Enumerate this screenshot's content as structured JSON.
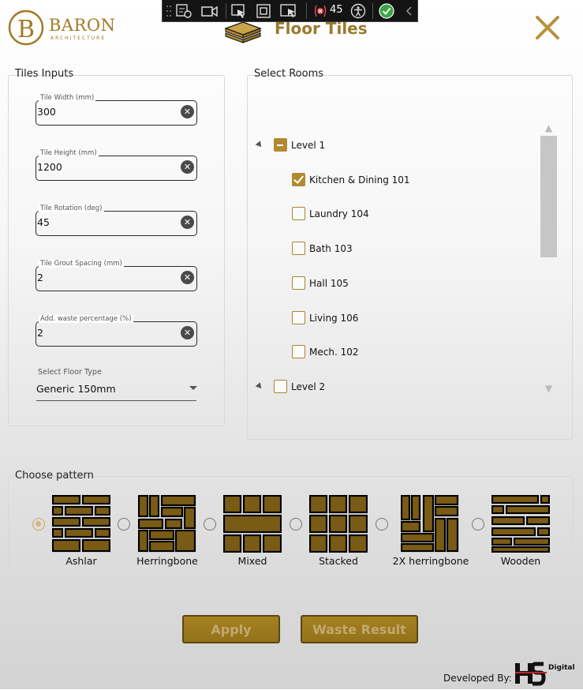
{
  "brand": {
    "name": "BARON",
    "tagline": "ARCHITECTURE",
    "monogram": "B"
  },
  "window": {
    "title": "Floor Tiles",
    "close_icon": "close-x-icon"
  },
  "devtools": {
    "error_count": "45"
  },
  "tile_inputs": {
    "group_label": "Tiles Inputs",
    "fields": [
      {
        "label": "Tile Width (mm)",
        "value": "300"
      },
      {
        "label": "Tile Height (mm)",
        "value": "1200"
      },
      {
        "label": "Tile Rotation (deg)",
        "value": "45"
      },
      {
        "label": "Tile Grout Spacing (mm)",
        "value": "2"
      },
      {
        "label": "Add. waste percentage (%)",
        "value": "2"
      }
    ],
    "floor_type": {
      "label": "Select Floor Type",
      "value": "Generic 150mm"
    }
  },
  "rooms": {
    "group_label": "Select Rooms",
    "levels": [
      {
        "label": "Level 1",
        "state": "partial",
        "items": [
          {
            "label": "Kitchen & Dining 101",
            "checked": true
          },
          {
            "label": "Laundry 104",
            "checked": false
          },
          {
            "label": "Bath 103",
            "checked": false
          },
          {
            "label": "Hall 105",
            "checked": false
          },
          {
            "label": "Living 106",
            "checked": false
          },
          {
            "label": "Mech. 102",
            "checked": false
          }
        ]
      },
      {
        "label": "Level 2",
        "state": "unchecked",
        "items": []
      }
    ]
  },
  "patterns": {
    "group_label": "Choose pattern",
    "selected": "Ashlar",
    "options": [
      "Ashlar",
      "Herringbone",
      "Mixed",
      "Stacked",
      "2X herringbone",
      "Wooden"
    ]
  },
  "actions": {
    "apply": "Apply",
    "waste_result": "Waste Result"
  },
  "footer": {
    "developed_by": "Developed By:",
    "dev_logo_text": "Digital"
  },
  "colors": {
    "gold": "#b08a30",
    "tile_fill": "#7a5b15",
    "button": "#9b7a1d"
  }
}
